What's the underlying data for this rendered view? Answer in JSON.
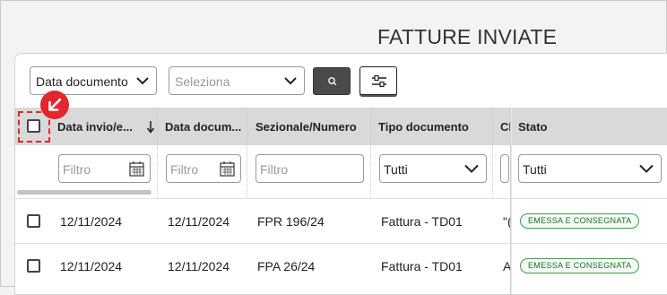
{
  "page": {
    "title": "FATTURE INVIATE"
  },
  "toolbar": {
    "sort_select_value": "Data documento",
    "selector_placeholder": "Seleziona"
  },
  "table": {
    "columns": [
      {
        "label": "Data invio/e..."
      },
      {
        "label": "Data docum..."
      },
      {
        "label": "Sezionale/Numero"
      },
      {
        "label": "Tipo documento"
      },
      {
        "label": "Cl"
      },
      {
        "label": "Stato"
      }
    ],
    "filters": {
      "date_placeholder": "Filtro",
      "doc_date_placeholder": "Filtro",
      "number_placeholder": "Filtro",
      "type_value": "Tutti",
      "state_value": "Tutti"
    },
    "rows": [
      {
        "sent_date": "12/11/2024",
        "doc_date": "12/11/2024",
        "number": "FPR 196/24",
        "type": "Fattura - TD01",
        "client": "\"(",
        "status": "EMESSA E CONSEGNATA"
      },
      {
        "sent_date": "12/11/2024",
        "doc_date": "12/11/2024",
        "number": "FPA 26/24",
        "type": "Fattura - TD01",
        "client": "A",
        "status": "EMESSA E CONSEGNATA"
      }
    ]
  },
  "colors": {
    "status_green": "#35a24a",
    "highlight_red": "#e0282e",
    "header_gray": "#d9d9d9"
  }
}
